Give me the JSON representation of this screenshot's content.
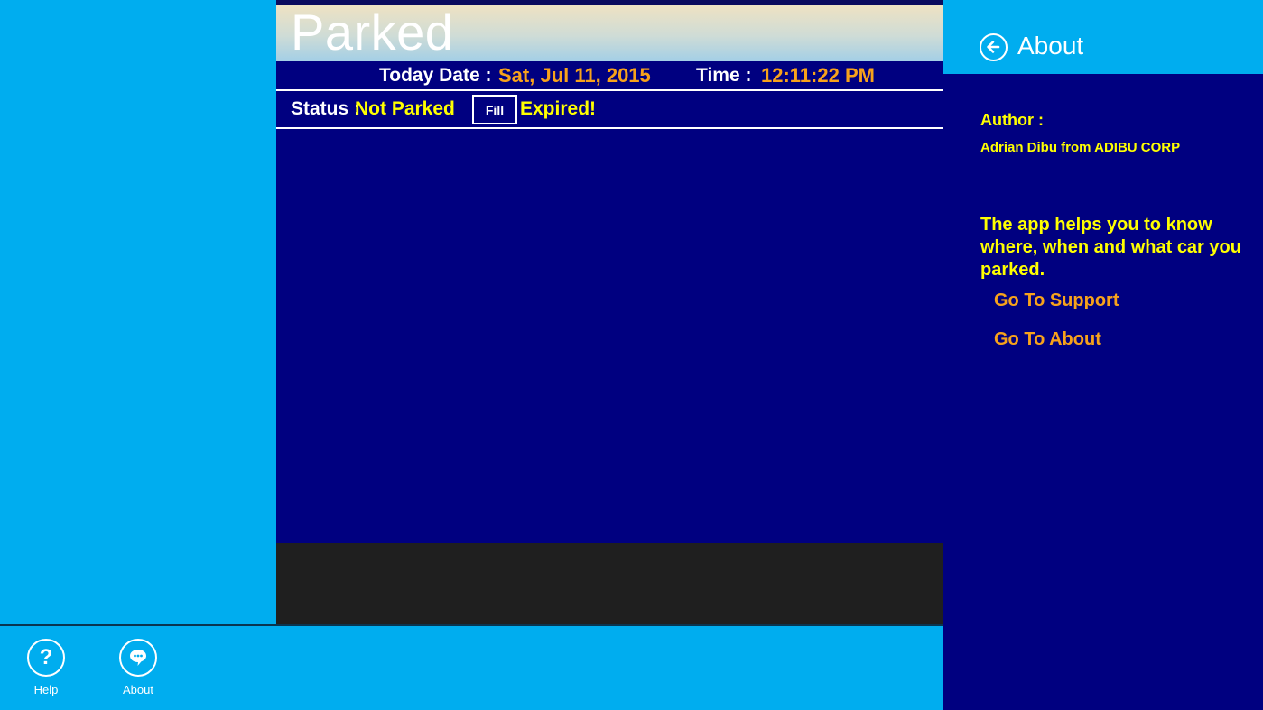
{
  "app": {
    "title": "Parked",
    "date_label": "Today Date :",
    "date_value": "Sat, Jul 11, 2015",
    "time_label": "Time :",
    "time_value": "12:11:22 PM",
    "status_label": "Status :",
    "status_value": "Not Parked",
    "fill_button": "Fill",
    "expired_text": "Expired!"
  },
  "appbar": {
    "help_label": "Help",
    "about_label": "About"
  },
  "about_panel": {
    "title": "About",
    "author_label": "Author :",
    "author_name": "Adrian Dibu from ADIBU CORP",
    "description": "The app helps you to know where, when and what car you parked.",
    "support_link": "Go To Support",
    "about_link": "Go To About"
  },
  "colors": {
    "main_bg": "#000080",
    "accent_blue": "#00adef",
    "highlight_orange": "#f7a21b",
    "highlight_yellow": "#ffff00",
    "dark_band": "#1f1f1f"
  }
}
